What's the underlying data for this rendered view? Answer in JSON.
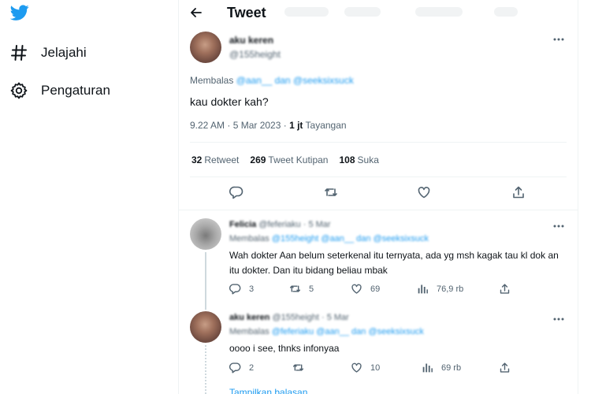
{
  "nav": {
    "logo_icon": "twitter-bird-icon",
    "items": [
      {
        "label": "Jelajahi",
        "icon": "hashtag-icon"
      },
      {
        "label": "Pengaturan",
        "icon": "gear-icon"
      }
    ]
  },
  "header": {
    "title": "Tweet",
    "back_icon": "arrow-left-icon"
  },
  "main_tweet": {
    "name": "aku keren",
    "handle": "@155height",
    "replying_prefix": "Membalas",
    "replying_to": "@aan__ dan @seeksixsuck",
    "text": "kau dokter kah?",
    "time": "9.22 AM · 5 Mar 2023 · ",
    "views_count": "1 jt",
    "views_label": "Tayangan",
    "stats": [
      {
        "count": "32",
        "label": "Retweet"
      },
      {
        "count": "269",
        "label": "Tweet Kutipan"
      },
      {
        "count": "108",
        "label": "Suka"
      }
    ]
  },
  "replies": [
    {
      "name": "Felicia",
      "handle_date": "@feferiaku · 5 Mar",
      "replying_prefix": "Membalas",
      "replying_to": "@155height @aan__ dan @seeksixsuck",
      "text": "Wah dokter Aan belum seterkenal itu ternyata, ada yg msh kagak tau kl dok an itu dokter. Dan itu bidang beliau mbak",
      "replies": "3",
      "retweets": "5",
      "likes": "69",
      "views": "76,9 rb"
    },
    {
      "name": "aku keren",
      "handle_date": "@155height · 5 Mar",
      "replying_prefix": "Membalas",
      "replying_to": "@feferiaku @aan__ dan @seeksixsuck",
      "text": "oooo i see, thnks infonyaa",
      "replies": "2",
      "retweets": "",
      "likes": "10",
      "views": "69 rb"
    }
  ],
  "show_replies": "Tampilkan balasan",
  "colors": {
    "accent": "#1d9bf0",
    "text": "#0f1419",
    "muted": "#536471",
    "border": "#eff3f4"
  }
}
